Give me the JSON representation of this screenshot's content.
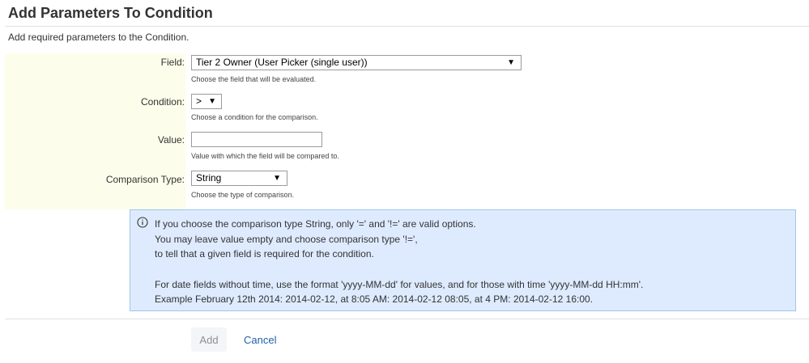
{
  "header": {
    "title": "Add Parameters To Condition",
    "subtitle": "Add required parameters to the Condition."
  },
  "form": {
    "field": {
      "label": "Field:",
      "value": "Tier 2 Owner (User Picker (single user))",
      "help": "Choose the field that will be evaluated."
    },
    "condition": {
      "label": "Condition:",
      "value": ">",
      "help": "Choose a condition for the comparison."
    },
    "value": {
      "label": "Value:",
      "value": "",
      "help": "Value with which the field will be compared to."
    },
    "comparison_type": {
      "label": "Comparison Type:",
      "value": "String",
      "help": "Choose the type of comparison."
    }
  },
  "info": {
    "icon": "info-circle-icon",
    "lines": [
      "If you choose the comparison type String, only '=' and '!=' are valid options.",
      "You may leave value empty and choose comparison type '!=',",
      "to tell that a given field is required for the condition.",
      "",
      "For date fields without time, use the format 'yyyy-MM-dd' for values, and for those with time 'yyyy-MM-dd HH:mm'.",
      "Example February 12th 2014: 2014-02-12, at 8:05 AM: 2014-02-12 08:05, at 4 PM: 2014-02-12 16:00."
    ]
  },
  "actions": {
    "add_label": "Add",
    "cancel_label": "Cancel"
  },
  "colors": {
    "form_label_bg": "#fdfdeb",
    "info_bg": "#deebff",
    "info_border": "#9fc5e8",
    "link": "#1f5fa8"
  }
}
